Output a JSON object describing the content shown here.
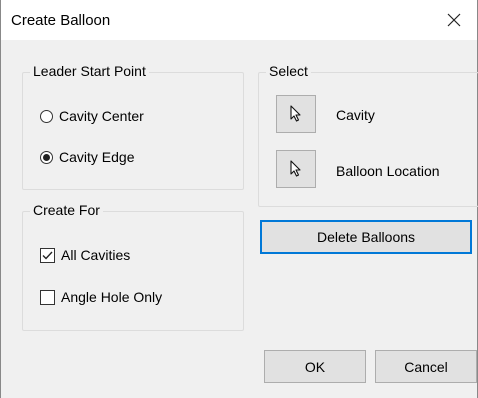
{
  "window": {
    "title": "Create Balloon",
    "close_glyph": "✕"
  },
  "leader_group": {
    "caption": "Leader Start Point",
    "options": [
      {
        "label": "Cavity Center",
        "checked": false
      },
      {
        "label": "Cavity Edge",
        "checked": true
      }
    ]
  },
  "create_for_group": {
    "caption": "Create For",
    "options": [
      {
        "label": "All Cavities",
        "checked": true
      },
      {
        "label": "Angle Hole Only",
        "checked": false
      }
    ]
  },
  "select_group": {
    "caption": "Select",
    "items": [
      {
        "label": "Cavity",
        "icon": "cursor-arrow-icon"
      },
      {
        "label": "Balloon Location",
        "icon": "cursor-arrow-icon"
      }
    ]
  },
  "buttons": {
    "delete": "Delete Balloons",
    "ok": "OK",
    "cancel": "Cancel"
  },
  "colors": {
    "accent": "#0078d7",
    "dialog_bg": "#f0f0f0"
  }
}
